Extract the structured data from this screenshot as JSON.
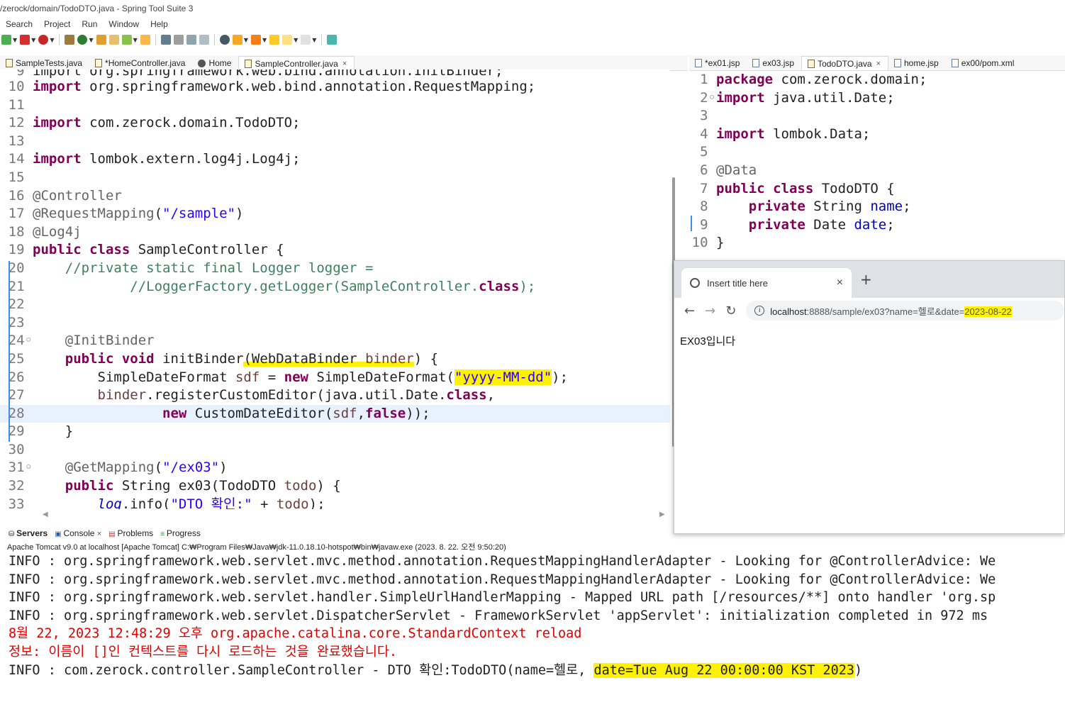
{
  "window": {
    "title": "/zerock/domain/TodoDTO.java - Spring Tool Suite 3"
  },
  "menu": [
    "Search",
    "Project",
    "Run",
    "Window",
    "Help"
  ],
  "left_tabs": [
    {
      "label": "SampleTests.java",
      "icon": "java-file-icon",
      "active": false
    },
    {
      "label": "*HomeController.java",
      "icon": "java-file-icon",
      "active": false
    },
    {
      "label": "Home",
      "icon": "globe-icon",
      "active": false
    },
    {
      "label": "SampleController.java",
      "icon": "java-file-icon",
      "active": true,
      "close": "×"
    }
  ],
  "right_tabs": [
    {
      "label": "*ex01.jsp",
      "active": false
    },
    {
      "label": "ex03.jsp",
      "active": false
    },
    {
      "label": "TodoDTO.java",
      "active": true,
      "close": "×"
    },
    {
      "label": "home.jsp",
      "active": false
    },
    {
      "label": "ex00/pom.xml",
      "active": false
    }
  ],
  "left_code": {
    "partial_top": "import org.springframework.web.bind.annotation.InitBinder;",
    "lines": [
      {
        "n": "10",
        "t": "import org.springframework.web.bind.annotation.RequestMapping;"
      },
      {
        "n": "11",
        "t": ""
      },
      {
        "n": "12",
        "t": "import com.zerock.domain.TodoDTO;"
      },
      {
        "n": "13",
        "t": ""
      },
      {
        "n": "14",
        "t": "import lombok.extern.log4j.Log4j;"
      },
      {
        "n": "15",
        "t": ""
      },
      {
        "n": "16",
        "t": "@Controller"
      },
      {
        "n": "17",
        "t": "@RequestMapping(\"/sample\")"
      },
      {
        "n": "18",
        "t": "@Log4j"
      },
      {
        "n": "19",
        "t": "public class SampleController {"
      },
      {
        "n": "20",
        "t": "    //private static final Logger logger ="
      },
      {
        "n": "21",
        "t": "            //LoggerFactory.getLogger(SampleController.class);"
      },
      {
        "n": "22",
        "t": ""
      },
      {
        "n": "23",
        "t": ""
      },
      {
        "n": "24",
        "t": "    @InitBinder"
      },
      {
        "n": "25",
        "t": "    public void initBinder(WebDataBinder binder) {"
      },
      {
        "n": "26",
        "t": "        SimpleDateFormat sdf = new SimpleDateFormat(\"yyyy-MM-dd\");"
      },
      {
        "n": "27",
        "t": "        binder.registerCustomEditor(java.util.Date.class,"
      },
      {
        "n": "28",
        "t": "                new CustomDateEditor(sdf,false));"
      },
      {
        "n": "29",
        "t": "    }"
      },
      {
        "n": "30",
        "t": ""
      },
      {
        "n": "31",
        "t": "    @GetMapping(\"/ex03\")"
      },
      {
        "n": "32",
        "t": "    public String ex03(TodoDTO todo) {"
      },
      {
        "n": "33",
        "t": "        log.info(\"DTO 확인:\" + todo);"
      }
    ]
  },
  "right_code": {
    "lines": [
      {
        "n": "1",
        "t": "package com.zerock.domain;"
      },
      {
        "n": "2",
        "t": "import java.util.Date;"
      },
      {
        "n": "3",
        "t": ""
      },
      {
        "n": "4",
        "t": "import lombok.Data;"
      },
      {
        "n": "5",
        "t": ""
      },
      {
        "n": "6",
        "t": "@Data"
      },
      {
        "n": "7",
        "t": "public class TodoDTO {"
      },
      {
        "n": "8",
        "t": "    private String name;"
      },
      {
        "n": "9",
        "t": "    private Date date;"
      },
      {
        "n": "10",
        "t": "}"
      }
    ]
  },
  "browser": {
    "tab_title": "Insert title here",
    "tab_close": "×",
    "new_tab": "+",
    "url_host": "localhost",
    "url_rest": ":8888/sample/ex03?name=헬로&date=",
    "url_highlight": "2023-08-22",
    "content": "EX03입니다",
    "back": "←",
    "forward": "→",
    "reload": "↻"
  },
  "bottom_tabs": [
    "Servers",
    "Console",
    "Problems",
    "Progress"
  ],
  "console": {
    "title": "Apache Tomcat v9.0  at localhost [Apache Tomcat] C:₩Program Files₩Java₩jdk-11.0.18.10-hotspot₩bin₩javaw.exe  (2023. 8. 22. 오전 9:50:20)",
    "lines": [
      {
        "t": "INFO : org.springframework.web.servlet.mvc.method.annotation.RequestMappingHandlerAdapter - Looking for @ControllerAdvice: We",
        "c": "black"
      },
      {
        "t": "INFO : org.springframework.web.servlet.mvc.method.annotation.RequestMappingHandlerAdapter - Looking for @ControllerAdvice: We",
        "c": "black"
      },
      {
        "t": "INFO : org.springframework.web.servlet.handler.SimpleUrlHandlerMapping - Mapped URL path [/resources/**] onto handler 'org.sp",
        "c": "black"
      },
      {
        "t": "INFO : org.springframework.web.servlet.DispatcherServlet - FrameworkServlet 'appServlet': initialization completed in 972 ms",
        "c": "black"
      },
      {
        "t": "8월 22, 2023 12:48:29 오후 org.apache.catalina.core.StandardContext reload",
        "c": "red"
      },
      {
        "t": "정보: 이름이 []인 컨텍스트를 다시 로드하는 것을 완료했습니다.",
        "c": "red"
      },
      {
        "t": "INFO : com.zerock.controller.SampleController - DTO 확인:TodoDTO(name=헬로, date=Tue Aug 22 00:00:00 KST 2023)",
        "c": "black"
      }
    ]
  },
  "colors": {
    "keyword": "#7f0055",
    "string": "#2a00ff",
    "comment": "#3f7f5f",
    "highlight": "#fff200",
    "console_red": "#e00000"
  }
}
